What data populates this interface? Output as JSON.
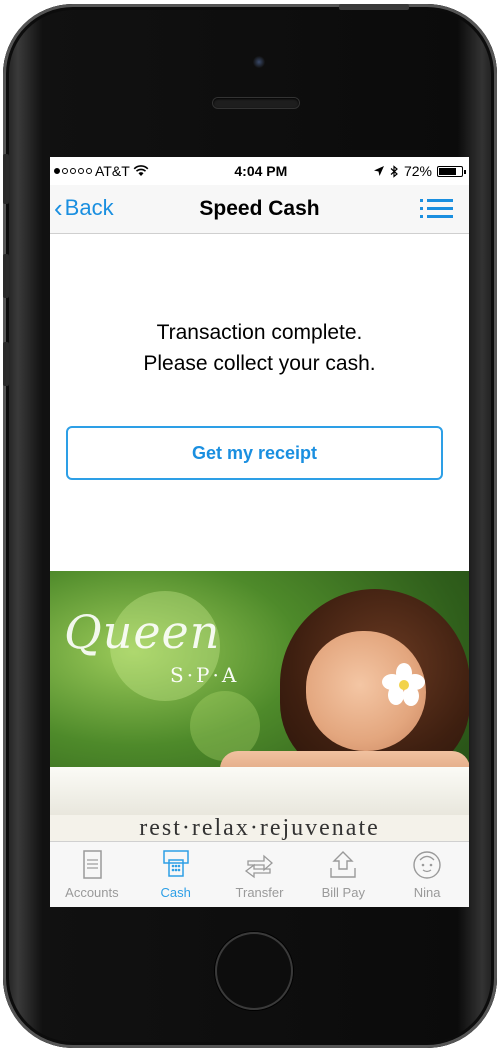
{
  "status_bar": {
    "carrier": "AT&T",
    "time": "4:04 PM",
    "battery": "72%"
  },
  "nav": {
    "back_label": "Back",
    "title": "Speed Cash"
  },
  "message": {
    "line1": "Transaction complete.",
    "line2": "Please collect your cash."
  },
  "receipt_button_label": "Get my receipt",
  "ad": {
    "logo": "Queen",
    "logo_sub": "S·P·A",
    "tagline": "rest·relax·rejuvenate"
  },
  "tabs": [
    {
      "label": "Accounts",
      "icon": "document-icon"
    },
    {
      "label": "Cash",
      "icon": "atm-cash-icon",
      "active": true
    },
    {
      "label": "Transfer",
      "icon": "transfer-arrows-icon"
    },
    {
      "label": "Bill Pay",
      "icon": "bill-pay-icon"
    },
    {
      "label": "Nina",
      "icon": "assistant-face-icon"
    }
  ],
  "colors": {
    "accent": "#1a8fe0",
    "tab_inactive": "#9a9a9a"
  }
}
